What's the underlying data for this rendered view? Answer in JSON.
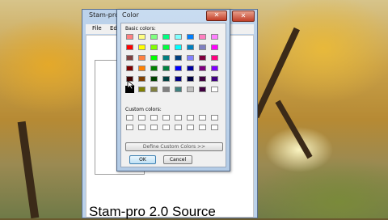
{
  "background_window": {
    "title": "Stam-pro",
    "menu": [
      "File",
      "Edi"
    ],
    "caption_text": "Stam-pro 2.0 Source",
    "minimize_label": "–",
    "maximize_label": "□",
    "close_label": "✕"
  },
  "color_dialog": {
    "title": "Color",
    "close_label": "✕",
    "basic_colors_label": "Basic colors:",
    "custom_colors_label": "Custom colors:",
    "define_custom_button": "Define Custom Colors >>",
    "ok_button": "OK",
    "cancel_button": "Cancel",
    "basic_colors": [
      [
        "#ff8080",
        "#ffff80",
        "#80ff80",
        "#00ff80",
        "#80ffff",
        "#0080ff",
        "#ff80c0",
        "#ff80ff"
      ],
      [
        "#ff0000",
        "#ffff00",
        "#80ff00",
        "#00ff40",
        "#00ffff",
        "#0080c0",
        "#8080c0",
        "#ff00ff"
      ],
      [
        "#804040",
        "#ff8040",
        "#00ff00",
        "#008080",
        "#004080",
        "#8080ff",
        "#800040",
        "#ff0080"
      ],
      [
        "#800000",
        "#ff8000",
        "#008000",
        "#008040",
        "#0000ff",
        "#0000a0",
        "#800080",
        "#8000ff"
      ],
      [
        "#400000",
        "#804000",
        "#004000",
        "#004040",
        "#000080",
        "#000040",
        "#400040",
        "#400080"
      ],
      [
        "#000000",
        "#808000",
        "#808040",
        "#808080",
        "#408080",
        "#c0c0c0",
        "#400040",
        "#ffffff"
      ]
    ],
    "selected_basic_color": "#000000",
    "custom_colors": [
      [
        "#ffffff",
        "#ffffff",
        "#ffffff",
        "#ffffff",
        "#ffffff",
        "#ffffff",
        "#ffffff",
        "#ffffff"
      ],
      [
        "#ffffff",
        "#ffffff",
        "#ffffff",
        "#ffffff",
        "#ffffff",
        "#ffffff",
        "#ffffff",
        "#ffffff"
      ]
    ]
  }
}
